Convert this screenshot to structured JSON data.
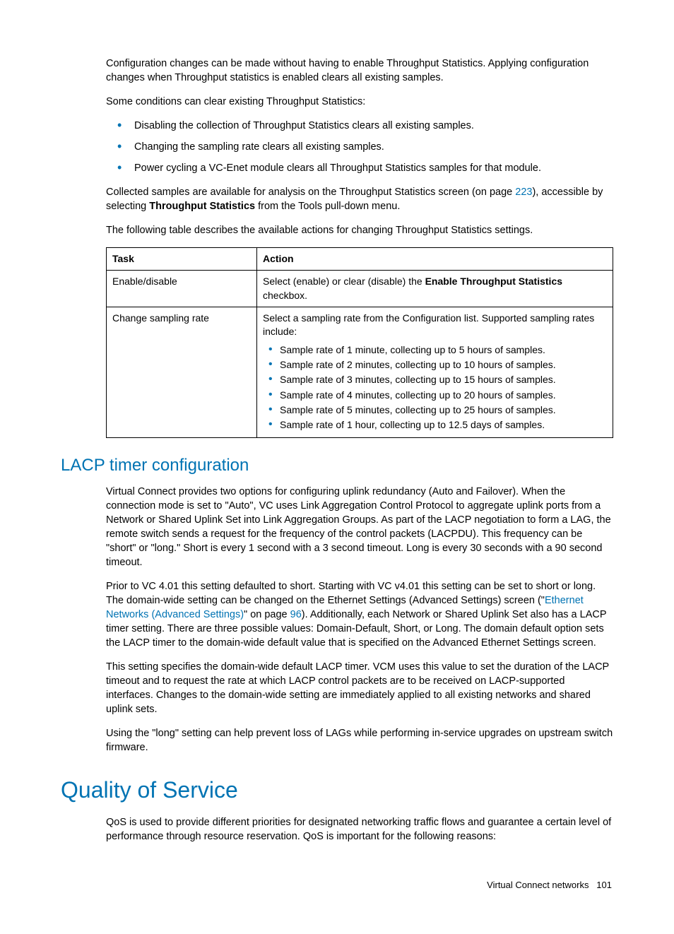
{
  "intro": {
    "p1": "Configuration changes can be made without having to enable Throughput Statistics. Applying configuration changes when Throughput statistics is enabled clears all existing samples.",
    "p2": "Some conditions can clear existing Throughput Statistics:",
    "bullets": [
      "Disabling the collection of Throughput Statistics clears all existing samples.",
      "Changing the sampling rate clears all existing samples.",
      "Power cycling a VC-Enet module clears all Throughput Statistics samples for that module."
    ],
    "p3a": "Collected samples are available for analysis on the Throughput Statistics screen (on page ",
    "p3_link": "223",
    "p3b": "), accessible by selecting ",
    "p3_bold": "Throughput Statistics",
    "p3c": " from the Tools pull-down menu.",
    "p4": "The following table describes the available actions for changing Throughput Statistics settings."
  },
  "table": {
    "headers": {
      "task": "Task",
      "action": "Action"
    },
    "rows": [
      {
        "task": "Enable/disable",
        "action_pre": "Select (enable) or clear (disable) the ",
        "action_bold": "Enable Throughput Statistics",
        "action_post": " checkbox."
      },
      {
        "task": "Change sampling rate",
        "action_pre": "Select a sampling rate from the Configuration list. Supported sampling rates include:",
        "bullets": [
          "Sample rate of 1 minute, collecting up to 5 hours of samples.",
          "Sample rate of 2 minutes, collecting up to 10 hours of samples.",
          "Sample rate of 3 minutes, collecting up to 15 hours of samples.",
          "Sample rate of 4 minutes, collecting up to 20 hours of samples.",
          "Sample rate of 5 minutes, collecting up to 25 hours of samples.",
          "Sample rate of 1 hour, collecting up to 12.5 days of samples."
        ]
      }
    ]
  },
  "lacp": {
    "heading": "LACP timer configuration",
    "p1": "Virtual Connect provides two options for configuring uplink redundancy (Auto and Failover). When the connection mode is set to \"Auto\", VC uses Link Aggregation Control Protocol to aggregate uplink ports from a Network or Shared Uplink Set into Link Aggregation Groups. As part of the LACP negotiation to form a LAG, the remote switch sends a request for the frequency of the control packets (LACPDU). This frequency can be \"short\" or \"long.\" Short is every 1 second with a 3 second timeout. Long is every 30 seconds with a 90 second timeout.",
    "p2a": "Prior to VC 4.01 this setting defaulted to short. Starting with VC v4.01 this setting can be set to short or long. The domain-wide setting can be changed on the Ethernet Settings (Advanced Settings) screen (\"",
    "p2_link1": "Ethernet Networks (Advanced Settings)",
    "p2b": "\" on page ",
    "p2_link2": "96",
    "p2c": "). Additionally, each Network or Shared Uplink Set also has a LACP timer setting. There are three possible values: Domain-Default, Short, or Long. The domain default option sets the LACP timer to the domain-wide default value that is specified on the Advanced Ethernet Settings screen.",
    "p3": "This setting specifies the domain-wide default LACP timer. VCM uses this value to set the duration of the LACP timeout and to request the rate at which LACP control packets are to be received on LACP-supported interfaces. Changes to the domain-wide setting are immediately applied to all existing networks and shared uplink sets.",
    "p4": "Using the \"long\" setting can help prevent loss of LAGs while performing in-service upgrades on upstream switch firmware."
  },
  "qos": {
    "heading": "Quality of Service",
    "p1": "QoS is used to provide different priorities for designated networking traffic flows and guarantee a certain level of performance through resource reservation. QoS is important for the following reasons:"
  },
  "footer": {
    "section": "Virtual Connect networks",
    "page": "101"
  }
}
